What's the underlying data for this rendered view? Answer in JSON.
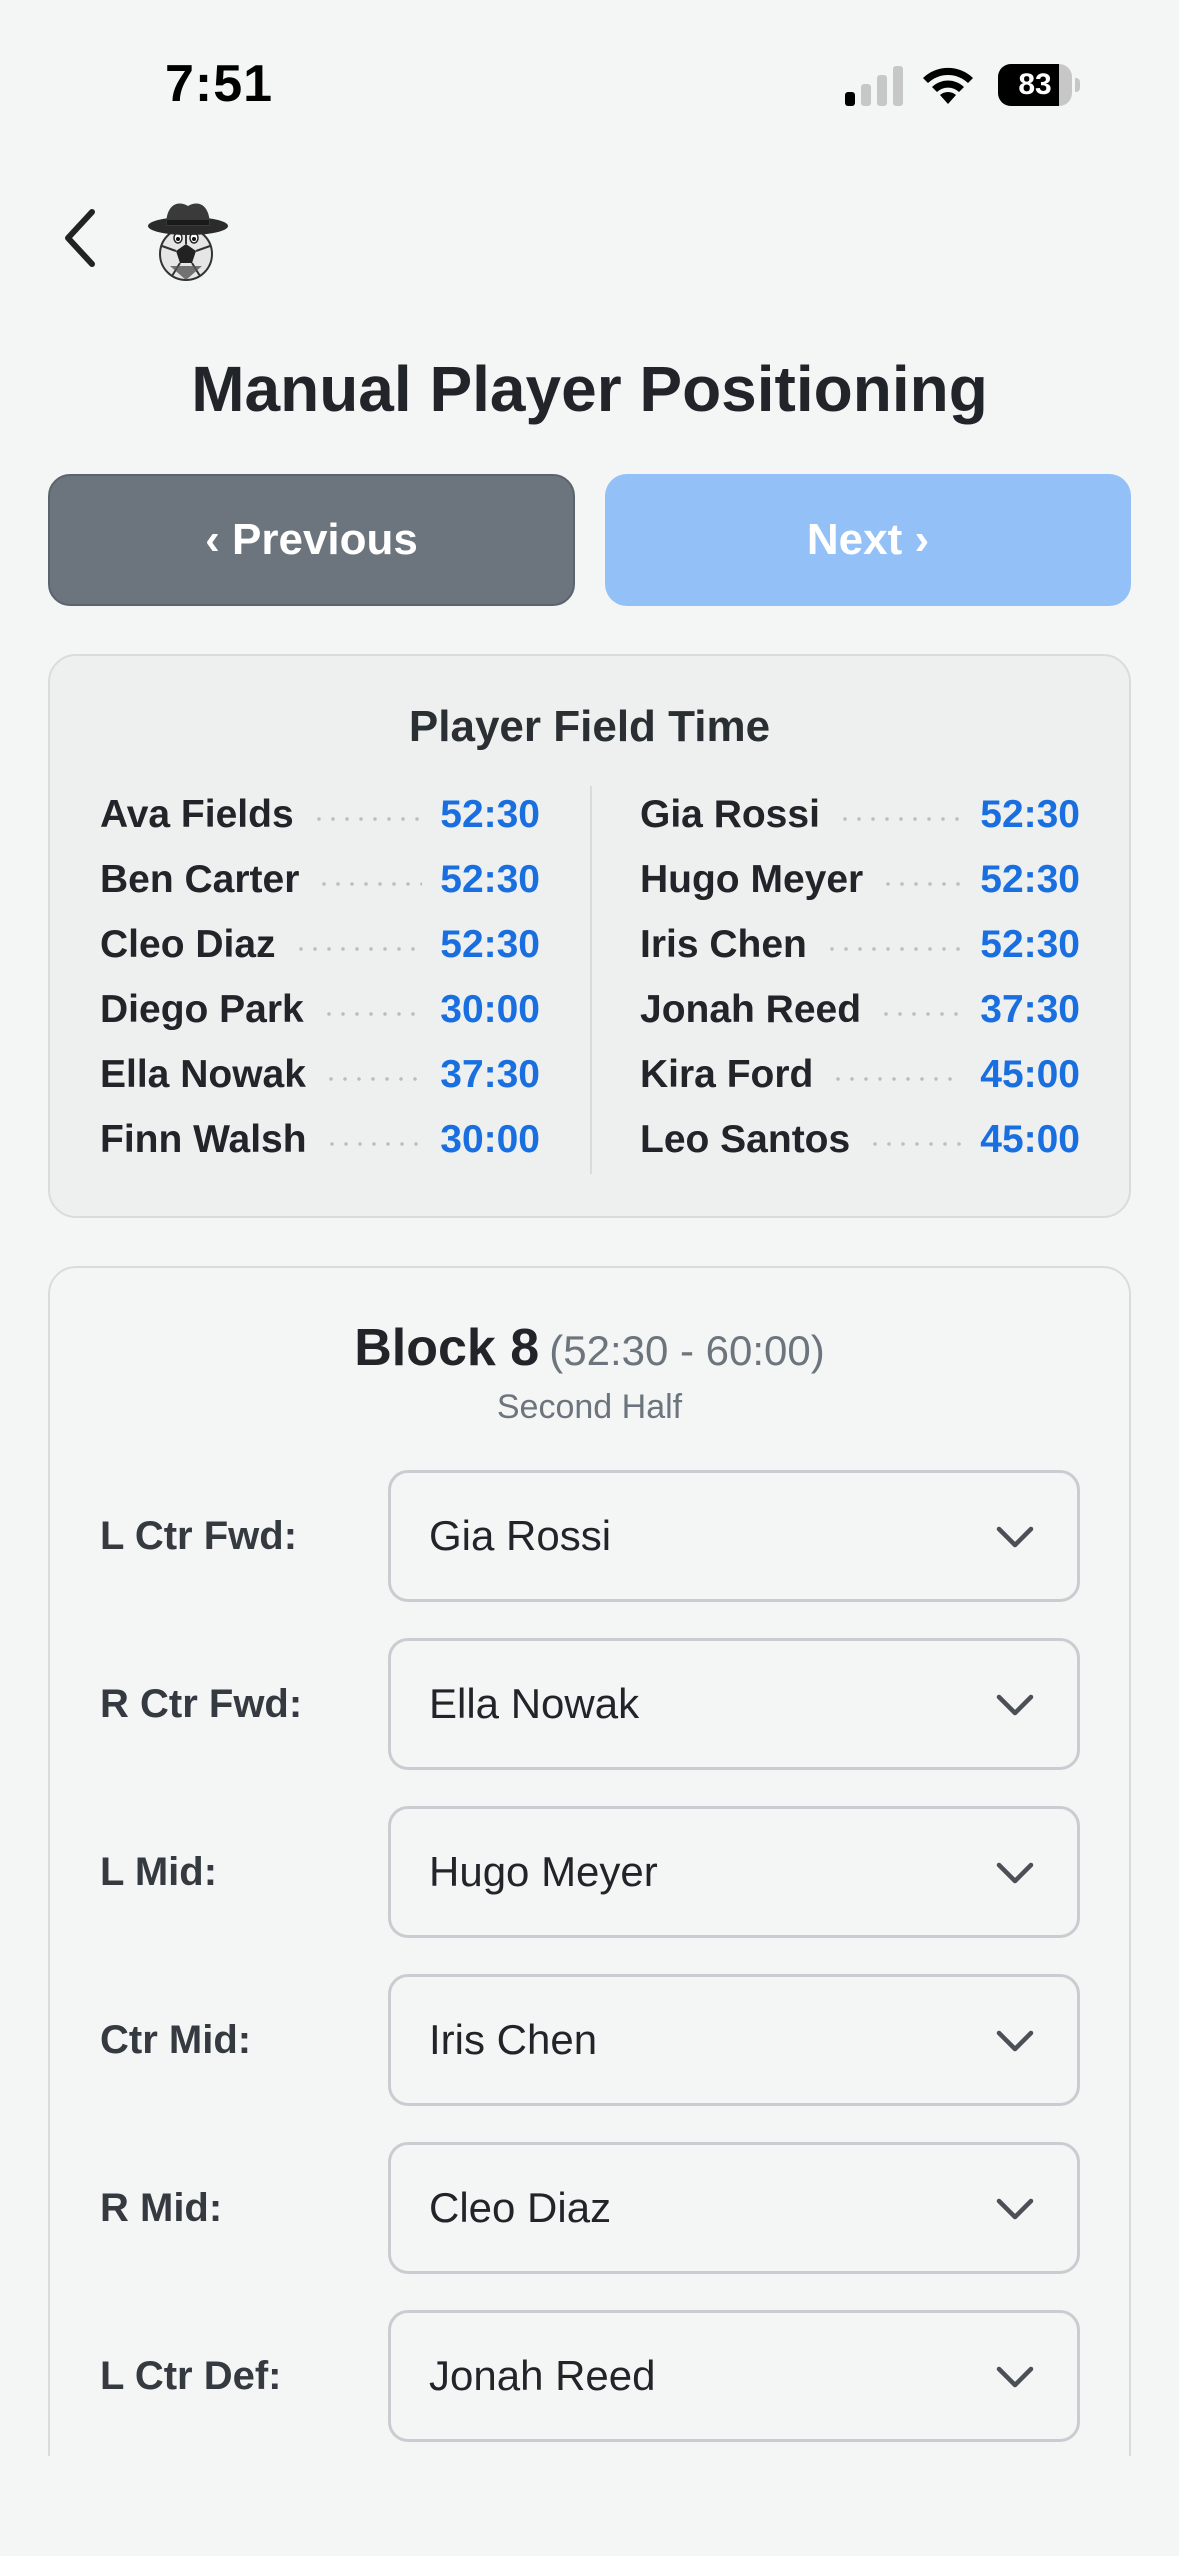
{
  "status_bar": {
    "time": "7:51",
    "battery_level": "83",
    "battery_fraction": 0.83,
    "signal_icon": "cellular-signal-icon",
    "wifi_icon": "wifi-icon"
  },
  "nav": {
    "back_icon": "chevron-left-icon",
    "logo_icon": "cowboy-soccer-ball-logo"
  },
  "page": {
    "title": "Manual Player Positioning"
  },
  "buttons": {
    "previous_label": "‹ Previous",
    "next_label": "Next ›"
  },
  "field_time": {
    "title": "Player Field Time",
    "left": [
      {
        "name": "Ava Fields",
        "time": "52:30"
      },
      {
        "name": "Ben Carter",
        "time": "52:30"
      },
      {
        "name": "Cleo Diaz",
        "time": "52:30"
      },
      {
        "name": "Diego Park",
        "time": "30:00"
      },
      {
        "name": "Ella Nowak",
        "time": "37:30"
      },
      {
        "name": "Finn Walsh",
        "time": "30:00"
      }
    ],
    "right": [
      {
        "name": "Gia Rossi",
        "time": "52:30"
      },
      {
        "name": "Hugo Meyer",
        "time": "52:30"
      },
      {
        "name": "Iris Chen",
        "time": "52:30"
      },
      {
        "name": "Jonah Reed",
        "time": "37:30"
      },
      {
        "name": "Kira Ford",
        "time": "45:00"
      },
      {
        "name": "Leo Santos",
        "time": "45:00"
      }
    ]
  },
  "block": {
    "title": "Block 8",
    "range": "(52:30 - 60:00)",
    "subtitle": "Second Half",
    "positions": [
      {
        "label": "L Ctr Fwd:",
        "player": "Gia Rossi"
      },
      {
        "label": "R Ctr Fwd:",
        "player": "Ella Nowak"
      },
      {
        "label": "L Mid:",
        "player": "Hugo Meyer"
      },
      {
        "label": "Ctr Mid:",
        "player": "Iris Chen"
      },
      {
        "label": "R Mid:",
        "player": "Cleo Diaz"
      },
      {
        "label": "L Ctr Def:",
        "player": "Jonah Reed"
      }
    ]
  },
  "colors": {
    "accent_blue": "#1a6fe0",
    "prev_button": "#6c757d",
    "next_button_disabled": "#93c1f7",
    "background": "#f4f5f5"
  }
}
